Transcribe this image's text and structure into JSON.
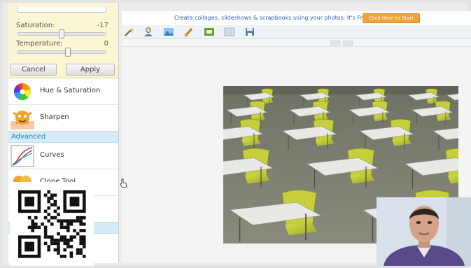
{
  "adjust_panel": {
    "saturation": {
      "label": "Saturation:",
      "value": "-17",
      "level": 0.5
    },
    "temperature": {
      "label": "Temperature:",
      "value": "0",
      "level": 0.58
    },
    "cancel_label": "Cancel",
    "apply_label": "Apply"
  },
  "tools": {
    "hue_saturation": {
      "label": "Hue & Saturation",
      "icon": "color-wheel-icon"
    },
    "sharpen": {
      "label": "Sharpen",
      "icon": "sharpen-face-icon"
    },
    "advanced_section": "Advanced",
    "curves": {
      "label": "Curves",
      "icon": "curves-icon"
    },
    "clone_tool": {
      "label": "Clone Tool",
      "icon": "clone-stamp-icon"
    }
  },
  "banner": {
    "text": "Create collages, slideshows & scrapbooks using your photos. It's Free!",
    "button_label": "Click Here to Start"
  },
  "toolbar": {
    "icons": [
      "wand-icon",
      "person-icon",
      "landscape-icon",
      "brush-icon",
      "frame-icon",
      "texture-icon",
      "save-icon"
    ]
  },
  "colors": {
    "panel_highlight": "#fbf7d4",
    "section_blue": "#d6ecf8",
    "section_text": "#1c7fc4",
    "banner_button": "#f2a13b",
    "chair_green": "#c6cf3b"
  },
  "photo": {
    "subject": "classroom-chairs-photo"
  },
  "overlays": {
    "qr": "qr-code",
    "webcam": "presenter-webcam"
  }
}
